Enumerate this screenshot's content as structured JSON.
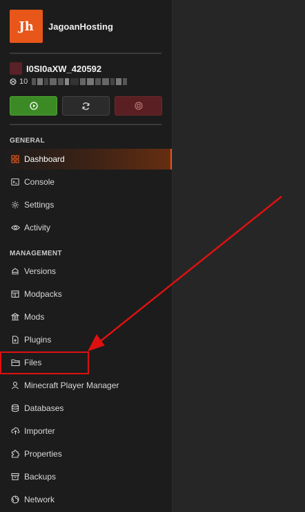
{
  "brand": {
    "logo_text": "Jh",
    "name": "JagoanHosting"
  },
  "server": {
    "name": "I0SI0aXW_420592",
    "ip_prefix": "10"
  },
  "power_buttons": {
    "start_icon": "play-icon",
    "restart_icon": "refresh-icon",
    "stop_icon": "stop-icon"
  },
  "sections": {
    "general": "GENERAL",
    "management": "MANAGEMENT"
  },
  "nav": {
    "general": [
      {
        "label": "Dashboard",
        "icon": "grid-icon",
        "active": true
      },
      {
        "label": "Console",
        "icon": "terminal-icon"
      },
      {
        "label": "Settings",
        "icon": "gear-icon"
      },
      {
        "label": "Activity",
        "icon": "eye-icon"
      }
    ],
    "management": [
      {
        "label": "Versions",
        "icon": "layers-icon"
      },
      {
        "label": "Modpacks",
        "icon": "package-icon"
      },
      {
        "label": "Mods",
        "icon": "bank-icon"
      },
      {
        "label": "Plugins",
        "icon": "plugin-file-icon"
      },
      {
        "label": "Files",
        "icon": "folder-icon"
      },
      {
        "label": "Minecraft Player Manager",
        "icon": "user-icon"
      },
      {
        "label": "Databases",
        "icon": "database-icon"
      },
      {
        "label": "Importer",
        "icon": "cloud-upload-icon"
      },
      {
        "label": "Properties",
        "icon": "puzzle-icon"
      },
      {
        "label": "Backups",
        "icon": "archive-icon"
      },
      {
        "label": "Network",
        "icon": "globe-icon"
      }
    ]
  },
  "colors": {
    "accent": "#e8561a",
    "annotation": "#e01010",
    "start": "#3c8a25",
    "stop": "#5a1f22"
  }
}
